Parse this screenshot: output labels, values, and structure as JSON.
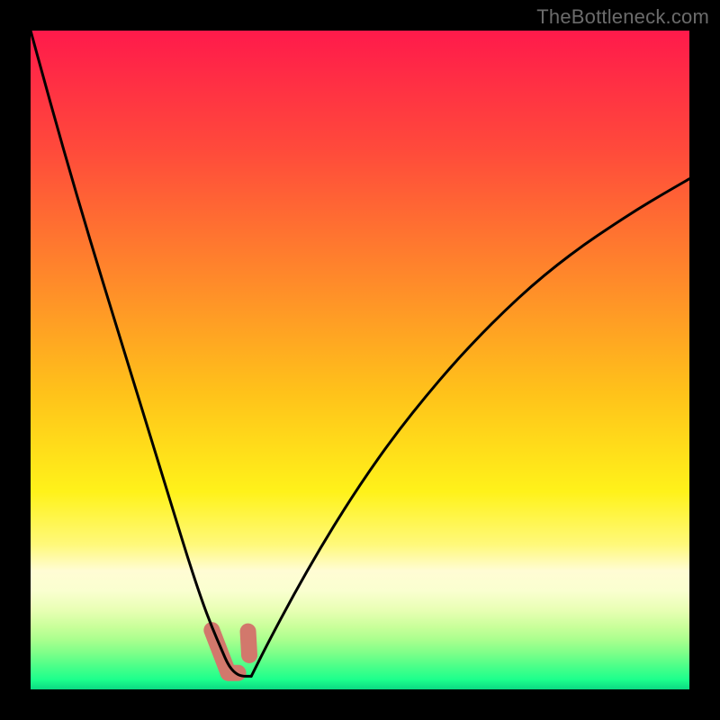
{
  "watermark": "TheBottleneck.com",
  "chart_data": {
    "type": "line",
    "title": "",
    "xlabel": "",
    "ylabel": "",
    "xlim": [
      0,
      1
    ],
    "ylim": [
      0,
      1
    ],
    "grid": false,
    "legend": false,
    "axes_visible": false,
    "background_gradient": {
      "type": "vertical",
      "stops": [
        {
          "pos": 0.0,
          "color": "#ff1a4b"
        },
        {
          "pos": 0.18,
          "color": "#ff4a3b"
        },
        {
          "pos": 0.38,
          "color": "#ff8a2a"
        },
        {
          "pos": 0.55,
          "color": "#ffc21a"
        },
        {
          "pos": 0.7,
          "color": "#fff21a"
        },
        {
          "pos": 0.78,
          "color": "#fff97a"
        },
        {
          "pos": 0.82,
          "color": "#fffcd4"
        },
        {
          "pos": 0.85,
          "color": "#faffd0"
        },
        {
          "pos": 0.88,
          "color": "#e8ffb4"
        },
        {
          "pos": 0.905,
          "color": "#c9ff9a"
        },
        {
          "pos": 0.925,
          "color": "#a9ff8e"
        },
        {
          "pos": 0.945,
          "color": "#7dff89"
        },
        {
          "pos": 0.965,
          "color": "#4bff89"
        },
        {
          "pos": 0.985,
          "color": "#1dff8c"
        },
        {
          "pos": 1.0,
          "color": "#0bd882"
        }
      ]
    },
    "highlight_band": {
      "y_min": 0.945,
      "y_max": 1.0,
      "color": "#1ee089"
    },
    "minimum_marker": {
      "x": 0.305,
      "y": 0.98,
      "color": "#d2786c",
      "segments": [
        {
          "from": [
            0.275,
            0.91
          ],
          "to": [
            0.3,
            0.975
          ]
        },
        {
          "from": [
            0.3,
            0.975
          ],
          "to": [
            0.315,
            0.975
          ]
        },
        {
          "from": [
            0.33,
            0.912
          ],
          "to": [
            0.332,
            0.948
          ]
        }
      ]
    },
    "series": [
      {
        "name": "left-branch",
        "stroke": "#000000",
        "x": [
          0.0,
          0.02,
          0.04,
          0.06,
          0.08,
          0.1,
          0.12,
          0.14,
          0.16,
          0.18,
          0.2,
          0.22,
          0.24,
          0.26,
          0.275,
          0.29,
          0.3,
          0.31,
          0.32,
          0.335
        ],
        "y": [
          0.0,
          0.073,
          0.145,
          0.215,
          0.283,
          0.35,
          0.415,
          0.48,
          0.545,
          0.61,
          0.675,
          0.74,
          0.805,
          0.865,
          0.905,
          0.94,
          0.963,
          0.975,
          0.98,
          0.98
        ]
      },
      {
        "name": "right-branch",
        "stroke": "#000000",
        "x": [
          0.335,
          0.36,
          0.4,
          0.44,
          0.48,
          0.52,
          0.56,
          0.6,
          0.64,
          0.68,
          0.72,
          0.76,
          0.8,
          0.84,
          0.88,
          0.92,
          0.96,
          1.0
        ],
        "y": [
          0.98,
          0.93,
          0.855,
          0.785,
          0.72,
          0.66,
          0.605,
          0.555,
          0.508,
          0.465,
          0.425,
          0.388,
          0.355,
          0.325,
          0.298,
          0.272,
          0.248,
          0.225
        ]
      }
    ]
  }
}
